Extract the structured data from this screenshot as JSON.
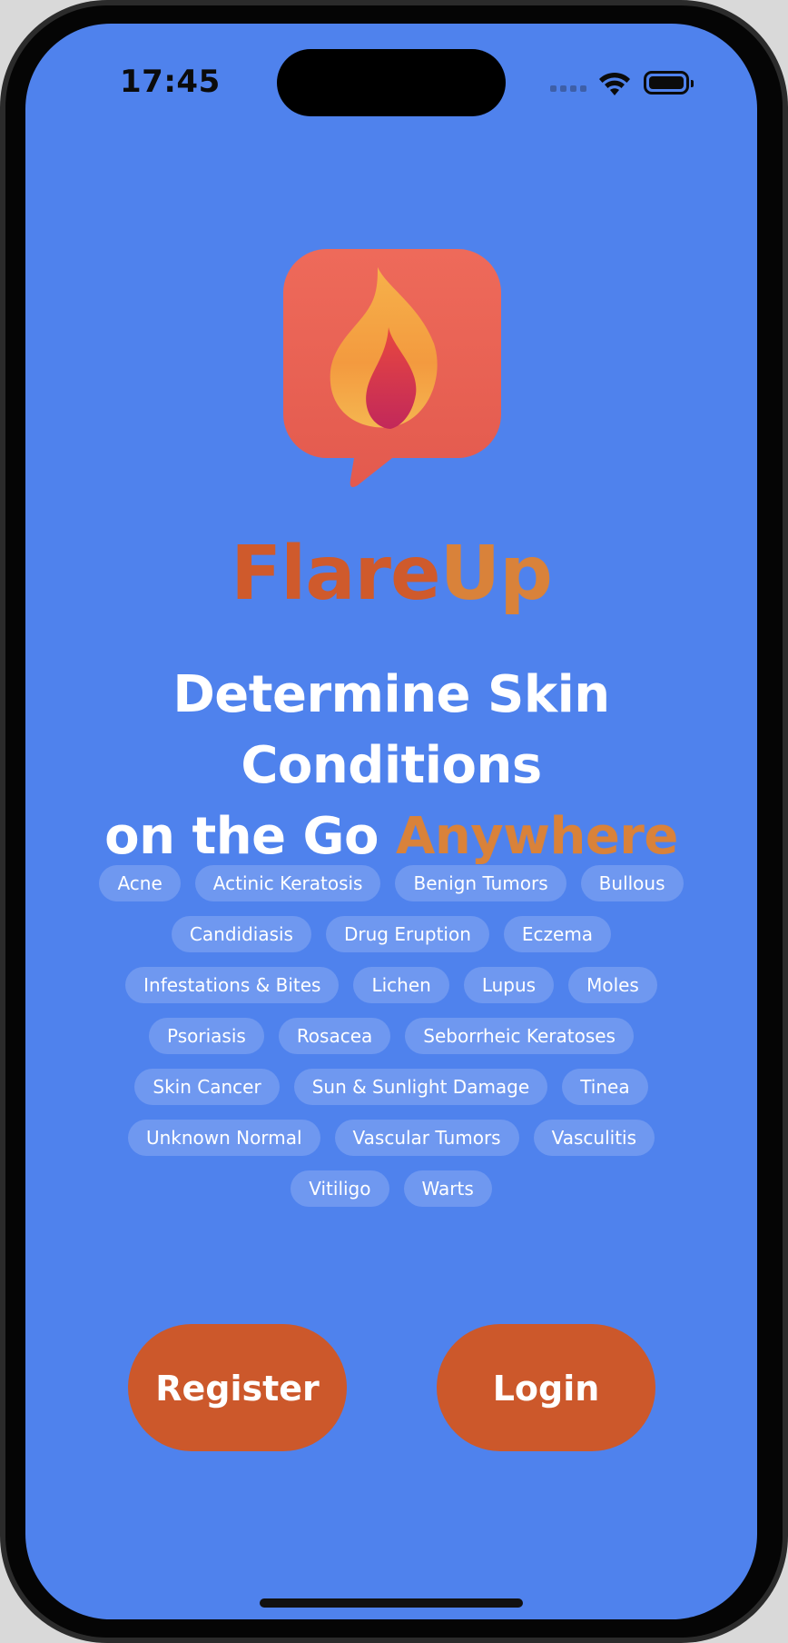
{
  "status_bar": {
    "time": "17:45"
  },
  "brand": {
    "name_part1": "Flare",
    "name_part2": "Up",
    "logo_icon": "flame-chat-bubble-icon"
  },
  "headline": {
    "line1": "Determine Skin Conditions",
    "line2_prefix": "on the Go ",
    "line2_accent": "Anywhere"
  },
  "conditions": [
    [
      "Acne",
      "Actinic Keratosis",
      "Benign Tumors",
      "Bullous"
    ],
    [
      "Candidiasis",
      "Drug Eruption",
      "Eczema"
    ],
    [
      "Infestations & Bites",
      "Lichen",
      "Lupus",
      "Moles"
    ],
    [
      "Psoriasis",
      "Rosacea",
      "Seborrheic Keratoses"
    ],
    [
      "Skin Cancer",
      "Sun & Sunlight Damage",
      "Tinea"
    ],
    [
      "Unknown Normal",
      "Vascular Tumors",
      "Vasculitis"
    ],
    [
      "Vitiligo",
      "Warts"
    ]
  ],
  "actions": {
    "register_label": "Register",
    "login_label": "Login"
  },
  "colors": {
    "background": "#4f82ed",
    "accent_orange": "#d9823a",
    "brand_red": "#cf5a2c",
    "button": "#cc582b",
    "chip": "#6f98f0"
  }
}
